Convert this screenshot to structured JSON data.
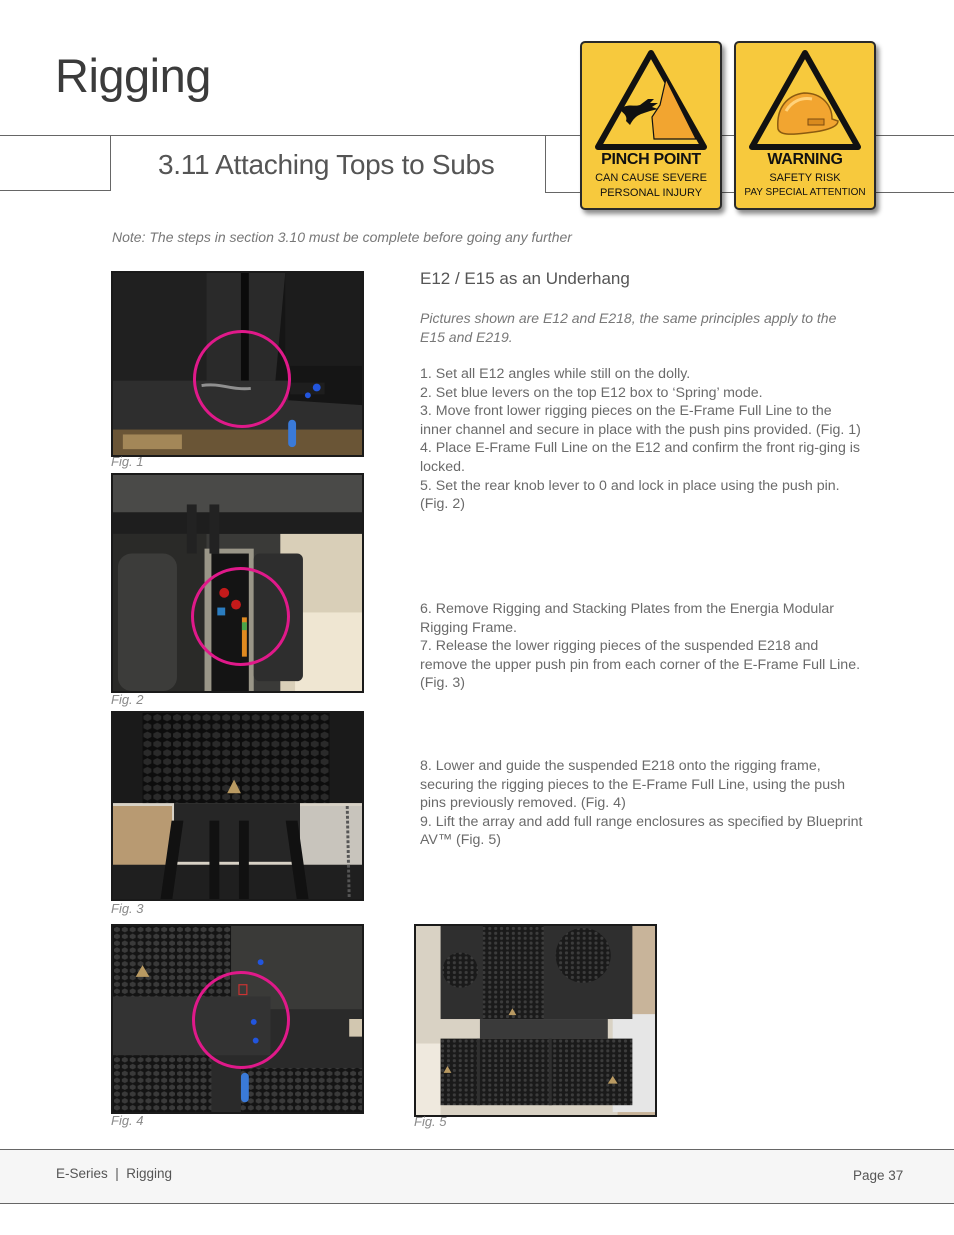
{
  "header": {
    "title": "Rigging",
    "section_title": "3.11 Attaching Tops to Subs"
  },
  "signs": [
    {
      "icon": "pinch-point-hand-icon",
      "title": "PINCH POINT",
      "line1": "CAN CAUSE SEVERE",
      "line2": "PERSONAL INJURY"
    },
    {
      "icon": "hard-hat-icon",
      "title": "WARNING",
      "line1": "SAFETY RISK",
      "line2": "PAY SPECIAL ATTENTION"
    }
  ],
  "note": "Note: The steps in section 3.10 must be complete before going any further",
  "content": {
    "subheading": "E12 / E15 as an Underhang",
    "intro": "Pictures shown are E12 and E218, the same principles apply to the E15 and E219.",
    "steps_group1": [
      "1. Set all E12 angles while still on the dolly.",
      "2. Set blue levers on the top E12 box to ‘Spring’ mode.",
      "3. Move front lower rigging pieces on the E-Frame Full Line to the inner channel and secure in place with the push pins provided. (Fig. 1)",
      "4. Place E-Frame Full Line on the E12 and confirm the front rig-ging is locked.",
      "5. Set the rear knob lever to 0 and lock in place using the push pin. (Fig. 2)"
    ],
    "steps_group2": [
      "6. Remove Rigging and Stacking Plates from the Energia Modular Rigging Frame.",
      "7. Release the lower rigging pieces of the suspended E218 and remove the upper push pin from each corner of the E-Frame Full Line. (Fig. 3)"
    ],
    "steps_group3": [
      "8. Lower and guide the suspended E218 onto the rigging frame, securing the rigging pieces to the E-Frame Full Line, using the push pins previously removed. (Fig. 4)",
      "9. Lift the array and add full range enclosures as specified by Blueprint AV™ (Fig. 5)"
    ]
  },
  "figures": [
    {
      "caption": "Fig. 1",
      "subject": "rigging channel close-up with push pins",
      "highlighted": true
    },
    {
      "caption": "Fig. 2",
      "subject": "rear knob lever with push pin",
      "highlighted": true
    },
    {
      "caption": "Fig. 3",
      "subject": "suspended E218 above rigging frame",
      "highlighted": false
    },
    {
      "caption": "Fig. 4",
      "subject": "rigging pieces secured with push pins",
      "highlighted": true
    },
    {
      "caption": "Fig. 5",
      "subject": "full range enclosures on subs",
      "highlighted": false
    }
  ],
  "colors": {
    "highlight_ring": "#e0198a",
    "sign_yellow": "#f7c93d",
    "sign_orange": "#f2a530"
  },
  "footer": {
    "left": "E-Series  |  Rigging",
    "page": "Page 37"
  }
}
